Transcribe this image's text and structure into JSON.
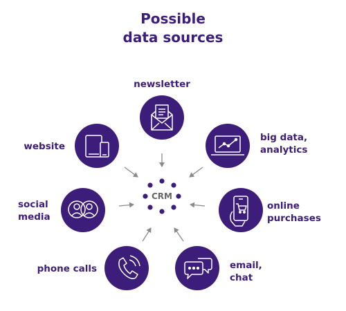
{
  "title": {
    "line1": "Possible",
    "line2": "data sources"
  },
  "center": {
    "label": "CRM"
  },
  "sources": {
    "newsletter": {
      "line1": "newsletter",
      "icon": "newsletter-envelope-icon"
    },
    "website": {
      "line1": "website",
      "icon": "tablet-phone-icon"
    },
    "big_data": {
      "line1": "big data,",
      "line2": "analytics",
      "icon": "analytics-monitor-icon"
    },
    "social_media": {
      "line1": "social",
      "line2": "media",
      "icon": "people-icon"
    },
    "online_purchases": {
      "line1": "online",
      "line2": "purchases",
      "icon": "mobile-shopping-icon"
    },
    "phone_calls": {
      "line1": "phone calls",
      "icon": "phone-icon"
    },
    "email_chat": {
      "line1": "email,",
      "line2": "chat",
      "icon": "chat-bubbles-icon"
    }
  },
  "colors": {
    "circle": "#3d1d7a",
    "text": "#3d1d7a",
    "arrow": "#8a8a8a",
    "dot": "#3d1d7a"
  }
}
